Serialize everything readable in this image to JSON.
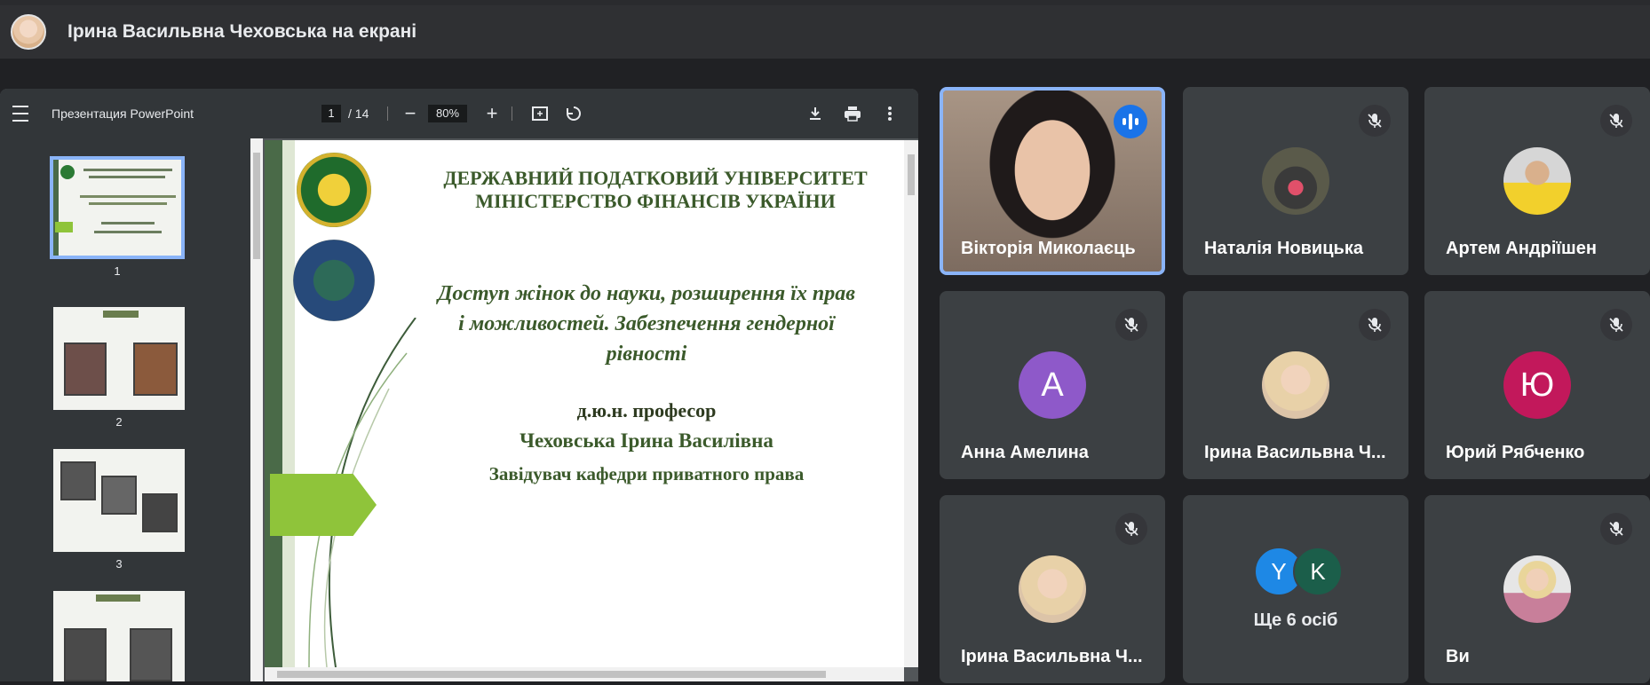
{
  "header": {
    "title": "Ірина Васильвна Чеховська на екрані"
  },
  "viewer": {
    "doc_title": "Презентация PowerPoint",
    "page_current": "1",
    "page_total": "/ 14",
    "zoom_minus": "−",
    "zoom_value": "80%",
    "zoom_plus": "+",
    "thumbnails": [
      "1",
      "2",
      "3"
    ]
  },
  "slide": {
    "heading1": "ДЕРЖАВНИЙ ПОДАТКОВИЙ УНІВЕРСИТЕТ",
    "heading2": "МІНІСТЕРСТВО ФІНАНСІВ УКРАЇНИ",
    "topic1": "Доступ жінок до науки, розширення їх прав",
    "topic2": "і можливостей. Забезпечення гендерної",
    "topic3": "рівності",
    "degree": "д.ю.н. професор",
    "author": "Чеховська Ірина Василівна",
    "position": "Завідувач кафедри приватного права"
  },
  "participants": [
    {
      "name": "Вікторія Миколаєць",
      "speaking": true
    },
    {
      "name": "Наталія Новицька",
      "muted": true
    },
    {
      "name": "Артем Андріїшен",
      "muted": true
    },
    {
      "name": "Анна Амелина",
      "muted": true,
      "initial": "A",
      "color": "#8e59c9"
    },
    {
      "name": "Ірина Васильвна Ч...",
      "muted": true
    },
    {
      "name": "Юрий Рябченко",
      "muted": true,
      "initial": "Ю",
      "color": "#c2185b"
    },
    {
      "name": "Ірина Васильвна Ч...",
      "muted": true
    },
    {
      "others_label": "Ще 6 осіб",
      "initials": [
        "Y",
        "K"
      ],
      "colors": [
        "#1e88e5",
        "#1b5e4a"
      ]
    },
    {
      "name": "Ви",
      "muted": true
    }
  ],
  "icons": {
    "menu": "menu-icon",
    "fit": "fit-page-icon",
    "rotate": "rotate-icon",
    "download": "download-icon",
    "print": "print-icon",
    "more": "more-vert-icon",
    "mic_off": "mic-off-icon",
    "speaking": "audio-wave-icon"
  }
}
